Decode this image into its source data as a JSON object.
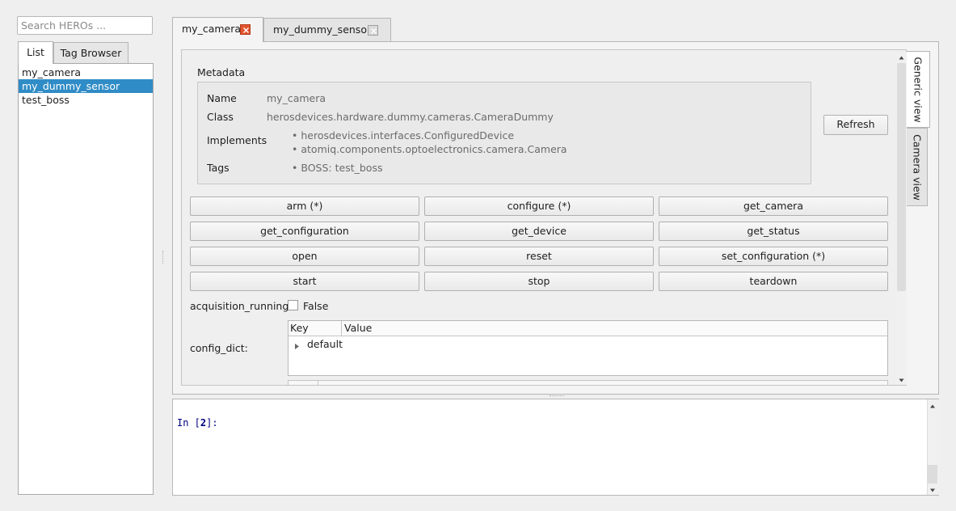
{
  "sidebar": {
    "search_placeholder": "Search HEROs ...",
    "tabs": [
      {
        "label": "List"
      },
      {
        "label": "Tag Browser"
      }
    ],
    "items": [
      {
        "label": "my_camera"
      },
      {
        "label": "my_dummy_sensor"
      },
      {
        "label": "test_boss"
      }
    ]
  },
  "tabs": [
    {
      "label": "my_camera"
    },
    {
      "label": "my_dummy_sensor"
    }
  ],
  "metadata": {
    "title": "Metadata",
    "name_label": "Name",
    "name_value": "my_camera",
    "class_label": "Class",
    "class_value": "herosdevices.hardware.dummy.cameras.CameraDummy",
    "implements_label": "Implements",
    "implements": [
      "herosdevices.interfaces.ConfiguredDevice",
      "atomiq.components.optoelectronics.camera.Camera"
    ],
    "tags_label": "Tags",
    "tags": [
      "BOSS: test_boss"
    ],
    "refresh_label": "Refresh"
  },
  "methods": [
    "arm (*)",
    "configure (*)",
    "get_camera",
    "get_configuration",
    "get_device",
    "get_status",
    "open",
    "reset",
    "set_configuration (*)",
    "start",
    "stop",
    "teardown"
  ],
  "properties": {
    "acquisition_label": "acquisition_running:",
    "acquisition_value": "False",
    "config_label": "config_dict:",
    "col_key": "Key",
    "col_value": "Value",
    "rows": [
      {
        "key": "default"
      }
    ]
  },
  "view_tabs": [
    {
      "label": "Generic view"
    },
    {
      "label": "Camera view"
    }
  ],
  "console": {
    "prompt_prefix": "In [",
    "prompt_number": "2",
    "prompt_suffix": "]:"
  },
  "colors": {
    "selection": "#308cc6",
    "close_active": "#e2552f",
    "prompt": "#000080"
  }
}
